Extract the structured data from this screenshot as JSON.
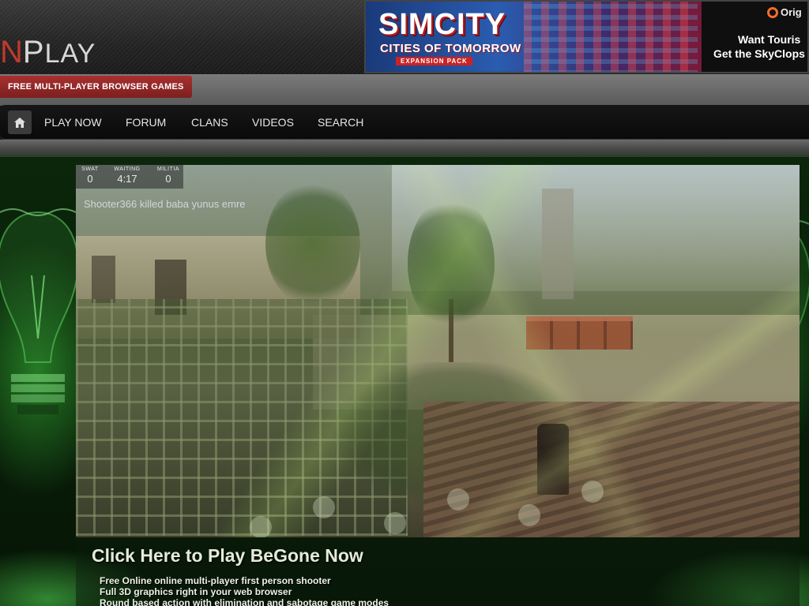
{
  "header": {
    "logo_first": "N",
    "logo_p": "P",
    "logo_rest": "LAY",
    "tagline": "FREE MULTI-PLAYER BROWSER GAMES"
  },
  "ad": {
    "title": "SIMCITY",
    "subtitle": "CITIES OF TOMORROW",
    "pack": "EXPANSION PACK",
    "brand": "Orig",
    "line1": "Want Touris",
    "line2": "Get the SkyClops"
  },
  "nav": {
    "home_icon": "home-icon",
    "items": [
      {
        "label": "PLAY NOW"
      },
      {
        "label": "FORUM"
      },
      {
        "label": "CLANS"
      },
      {
        "label": "VIDEOS"
      },
      {
        "label": "SEARCH"
      }
    ]
  },
  "hud": {
    "teams": [
      {
        "label": "SWAT",
        "value": "0"
      },
      {
        "label": "WAITING",
        "value": "4:17"
      },
      {
        "label": "MILITIA",
        "value": "0"
      }
    ],
    "killfeed": "Shooter366 killed baba yunus emre"
  },
  "cta": {
    "title": "Click Here to Play BeGone Now",
    "features": [
      "Free Online online multi-player first person shooter",
      "Full 3D graphics right in your web browser",
      "Round based action with elimination and sabotage game modes"
    ]
  },
  "colors": {
    "accent_red": "#a83030",
    "nav_bg": "#0f0f0f",
    "glow_green": "#3cc83c"
  }
}
